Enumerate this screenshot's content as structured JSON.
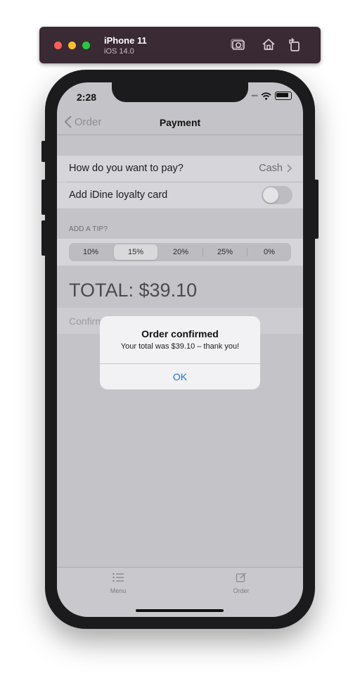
{
  "simulator": {
    "device_name": "iPhone 11",
    "os_version": "iOS 14.0",
    "screenshot_icon": "camera-icon",
    "home_icon": "home-icon",
    "rotate_icon": "rotate-icon"
  },
  "status_bar": {
    "time": "2:28",
    "signal_dots": "••••"
  },
  "nav": {
    "back_label": "Order",
    "title": "Payment"
  },
  "payment": {
    "pay_label": "How do you want to pay?",
    "pay_value": "Cash",
    "loyalty_label": "Add iDine loyalty card",
    "loyalty_enabled": false
  },
  "tip": {
    "header": "ADD A TIP?",
    "options": [
      "10%",
      "15%",
      "20%",
      "25%",
      "0%"
    ],
    "selected": "15%"
  },
  "total": {
    "text": "TOTAL: $39.10"
  },
  "confirm": {
    "label": "Confirm order"
  },
  "alert": {
    "title": "Order confirmed",
    "message": "Your total was $39.10 – thank you!",
    "button": "OK"
  },
  "tabs": [
    {
      "label": "Menu",
      "icon": "list-icon"
    },
    {
      "label": "Order",
      "icon": "edit-square-icon"
    }
  ],
  "colors": {
    "accent": "#1a73d6",
    "dim_overlay_bg": "#c4c4c8"
  }
}
